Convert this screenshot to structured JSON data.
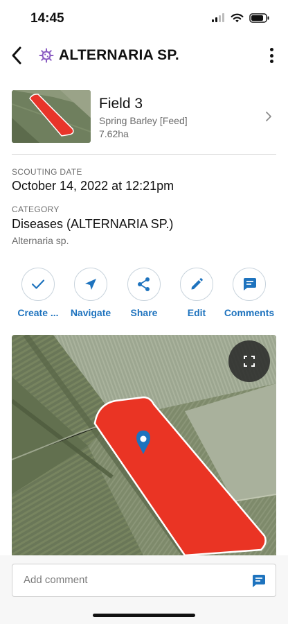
{
  "status_bar": {
    "time": "14:45",
    "icons": [
      "cellular-signal-icon",
      "wifi-icon",
      "battery-icon"
    ]
  },
  "header": {
    "back_icon": "chevron-left-icon",
    "category_icon": "virus-icon",
    "title": "ALTERNARIA SP.",
    "more_icon": "vertical-dots-icon"
  },
  "field": {
    "name": "Field 3",
    "crop": "Spring Barley [Feed]",
    "area": "7.62ha",
    "chevron_icon": "chevron-right-icon"
  },
  "scouting": {
    "date_label": "SCOUTING DATE",
    "date_value": "October 14, 2022 at 12:21pm",
    "category_label": "CATEGORY",
    "category_value": "Diseases (ALTERNARIA SP.)",
    "category_sub": "Alternaria sp."
  },
  "actions": [
    {
      "label": "Create ...",
      "icon": "checkmark-icon"
    },
    {
      "label": "Navigate",
      "icon": "navigation-arrow-icon"
    },
    {
      "label": "Share",
      "icon": "share-icon"
    },
    {
      "label": "Edit",
      "icon": "pencil-icon"
    },
    {
      "label": "Comments",
      "icon": "comment-bubble-icon"
    }
  ],
  "map": {
    "expand_icon": "fullscreen-icon",
    "pin_icon": "map-pin-icon"
  },
  "comment": {
    "placeholder": "Add comment",
    "send_icon": "comment-bubble-icon"
  },
  "colors": {
    "accent": "#1e73be",
    "field_overlay": "#e8342a",
    "virus_icon": "#8a5cc2"
  }
}
